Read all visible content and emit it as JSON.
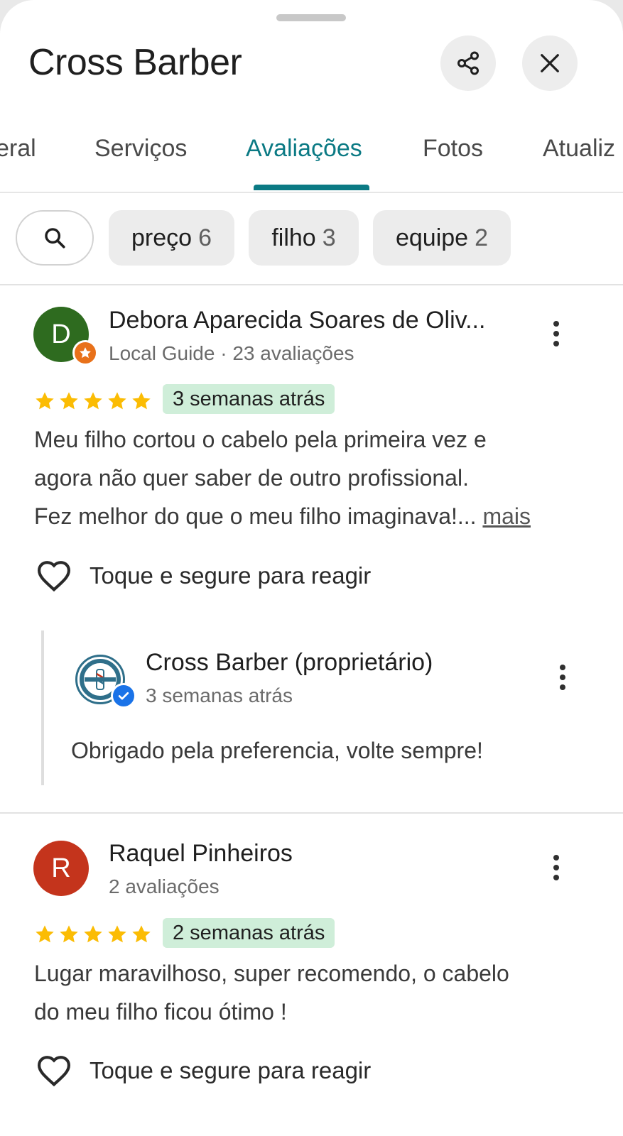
{
  "header": {
    "title": "Cross Barber",
    "share_icon": "share-icon",
    "close_icon": "close-icon"
  },
  "tabs": [
    {
      "label": "Visão geral",
      "visible_label": "eral"
    },
    {
      "label": "Serviços"
    },
    {
      "label": "Avaliações",
      "active": true
    },
    {
      "label": "Fotos"
    },
    {
      "label": "Atualiz"
    }
  ],
  "filters": {
    "search_icon": "search-icon",
    "chips": [
      {
        "label": "preço",
        "count": "6"
      },
      {
        "label": "filho",
        "count": "3"
      },
      {
        "label": "equipe",
        "count": "2"
      }
    ]
  },
  "reviews": [
    {
      "avatar_letter": "D",
      "avatar_color": "#2e6b1f",
      "name": "Debora Aparecida Soares de Oliv...",
      "meta": "Local Guide · 23 avaliações",
      "rating": 5,
      "date": "3 semanas atrás",
      "text": "Meu filho cortou o cabelo pela primeira vez e agora não quer saber de outro profissional. Fez melhor do que o meu filho imaginava!...",
      "text_lines": [
        "Meu filho cortou o cabelo pela primeira vez e",
        "agora não quer saber de outro profissional.",
        "Fez melhor do que o meu filho imaginava!..."
      ],
      "more": "mais",
      "react_label": "Toque e segure para reagir",
      "owner_reply": {
        "name": "Cross Barber (proprietário)",
        "date": "3 semanas atrás",
        "text": "Obrigado pela preferencia, volte sempre!"
      }
    },
    {
      "avatar_letter": "R",
      "avatar_color": "#c4341c",
      "name": "Raquel Pinheiros",
      "meta": "2 avaliações",
      "rating": 5,
      "date": "2 semanas atrás",
      "text_lines": [
        "Lugar maravilhoso, super recomendo, o cabelo",
        "do meu filho ficou ótimo !"
      ],
      "react_label": "Toque e segure para reagir"
    }
  ],
  "colors": {
    "accent": "#0b7a84",
    "star": "#fbbc04",
    "date_badge_bg": "#cfeed9",
    "verified": "#1a73e8",
    "local_guide": "#e8711a"
  }
}
